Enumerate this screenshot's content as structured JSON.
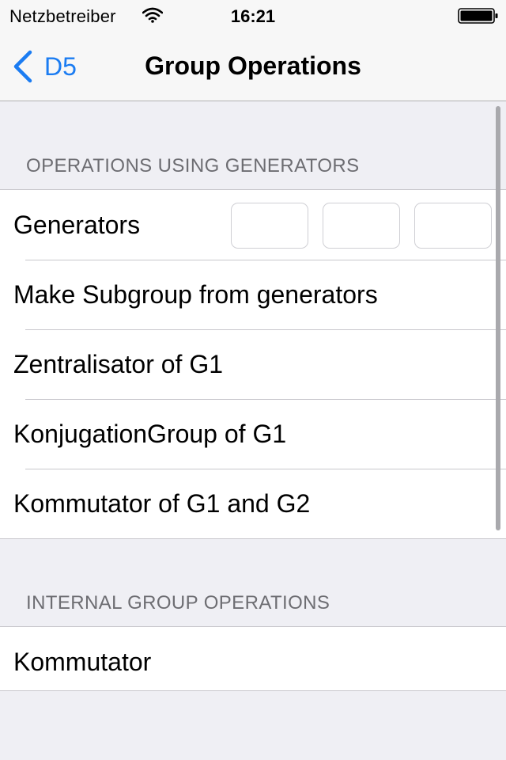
{
  "status_bar": {
    "carrier": "Netzbetreiber",
    "time": "16:21",
    "wifi_icon": "wifi-icon",
    "battery_icon": "battery-full-icon"
  },
  "nav": {
    "back_label": "D5",
    "back_icon": "chevron-left-icon",
    "title": "Group Operations",
    "accent_color": "#1b7cf2"
  },
  "sections": [
    {
      "header": "OPERATIONS USING GENERATORS",
      "rows": [
        {
          "label": "Generators",
          "fields": [
            "",
            "",
            ""
          ]
        },
        {
          "label": "Make Subgroup from generators"
        },
        {
          "label": "Zentralisator of G1"
        },
        {
          "label": "KonjugationGroup of G1"
        },
        {
          "label": "Kommutator of G1 and G2"
        }
      ]
    },
    {
      "header": "INTERNAL GROUP OPERATIONS",
      "rows": [
        {
          "label": "Kommutator"
        }
      ]
    }
  ]
}
